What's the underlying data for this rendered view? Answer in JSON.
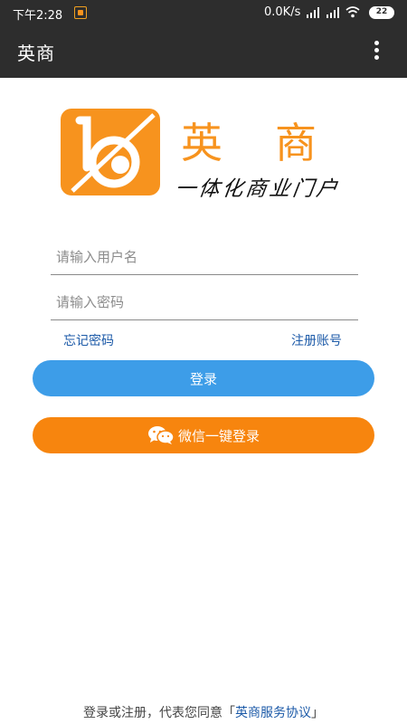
{
  "status_bar": {
    "time": "下午2:28",
    "network_speed": "0.0K/s",
    "battery": "22"
  },
  "app_bar": {
    "title": "英商"
  },
  "logo": {
    "brand_name": "英商",
    "tagline": "一体化商业门户"
  },
  "form": {
    "username_placeholder": "请输入用户名",
    "password_placeholder": "请输入密码",
    "forgot_password": "忘记密码",
    "register_account": "注册账号",
    "login_button": "登录",
    "wechat_login_button": "微信一键登录"
  },
  "footer": {
    "text": "登录或注册，代表您同意「",
    "agreement": "英商服务协议",
    "close": "」"
  },
  "colors": {
    "brand_orange": "#f7931e",
    "login_blue": "#3d9de8",
    "wechat_orange": "#f7850e",
    "link_blue": "#1c5aa8",
    "bar_dark": "#2d2d2d"
  }
}
